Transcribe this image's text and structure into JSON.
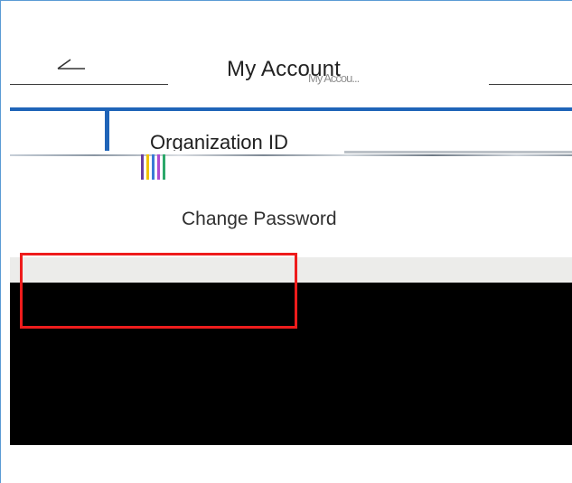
{
  "header": {
    "back_icon": "arrow-left-icon",
    "title": "My Account",
    "title_ghost": "My Accou..."
  },
  "account": {
    "organization_label": "Organization ID",
    "change_password_label": "Change Password"
  },
  "colors": {
    "accent_blue": "#1f64b8",
    "frame_border": "#5b9bd5",
    "highlight_red": "#ee1c1c",
    "band_gray": "#ececea",
    "stripes": [
      "#6a3fa0",
      "#f2c200",
      "#3a7bd5",
      "#b04ad0",
      "#2ca86a"
    ]
  }
}
